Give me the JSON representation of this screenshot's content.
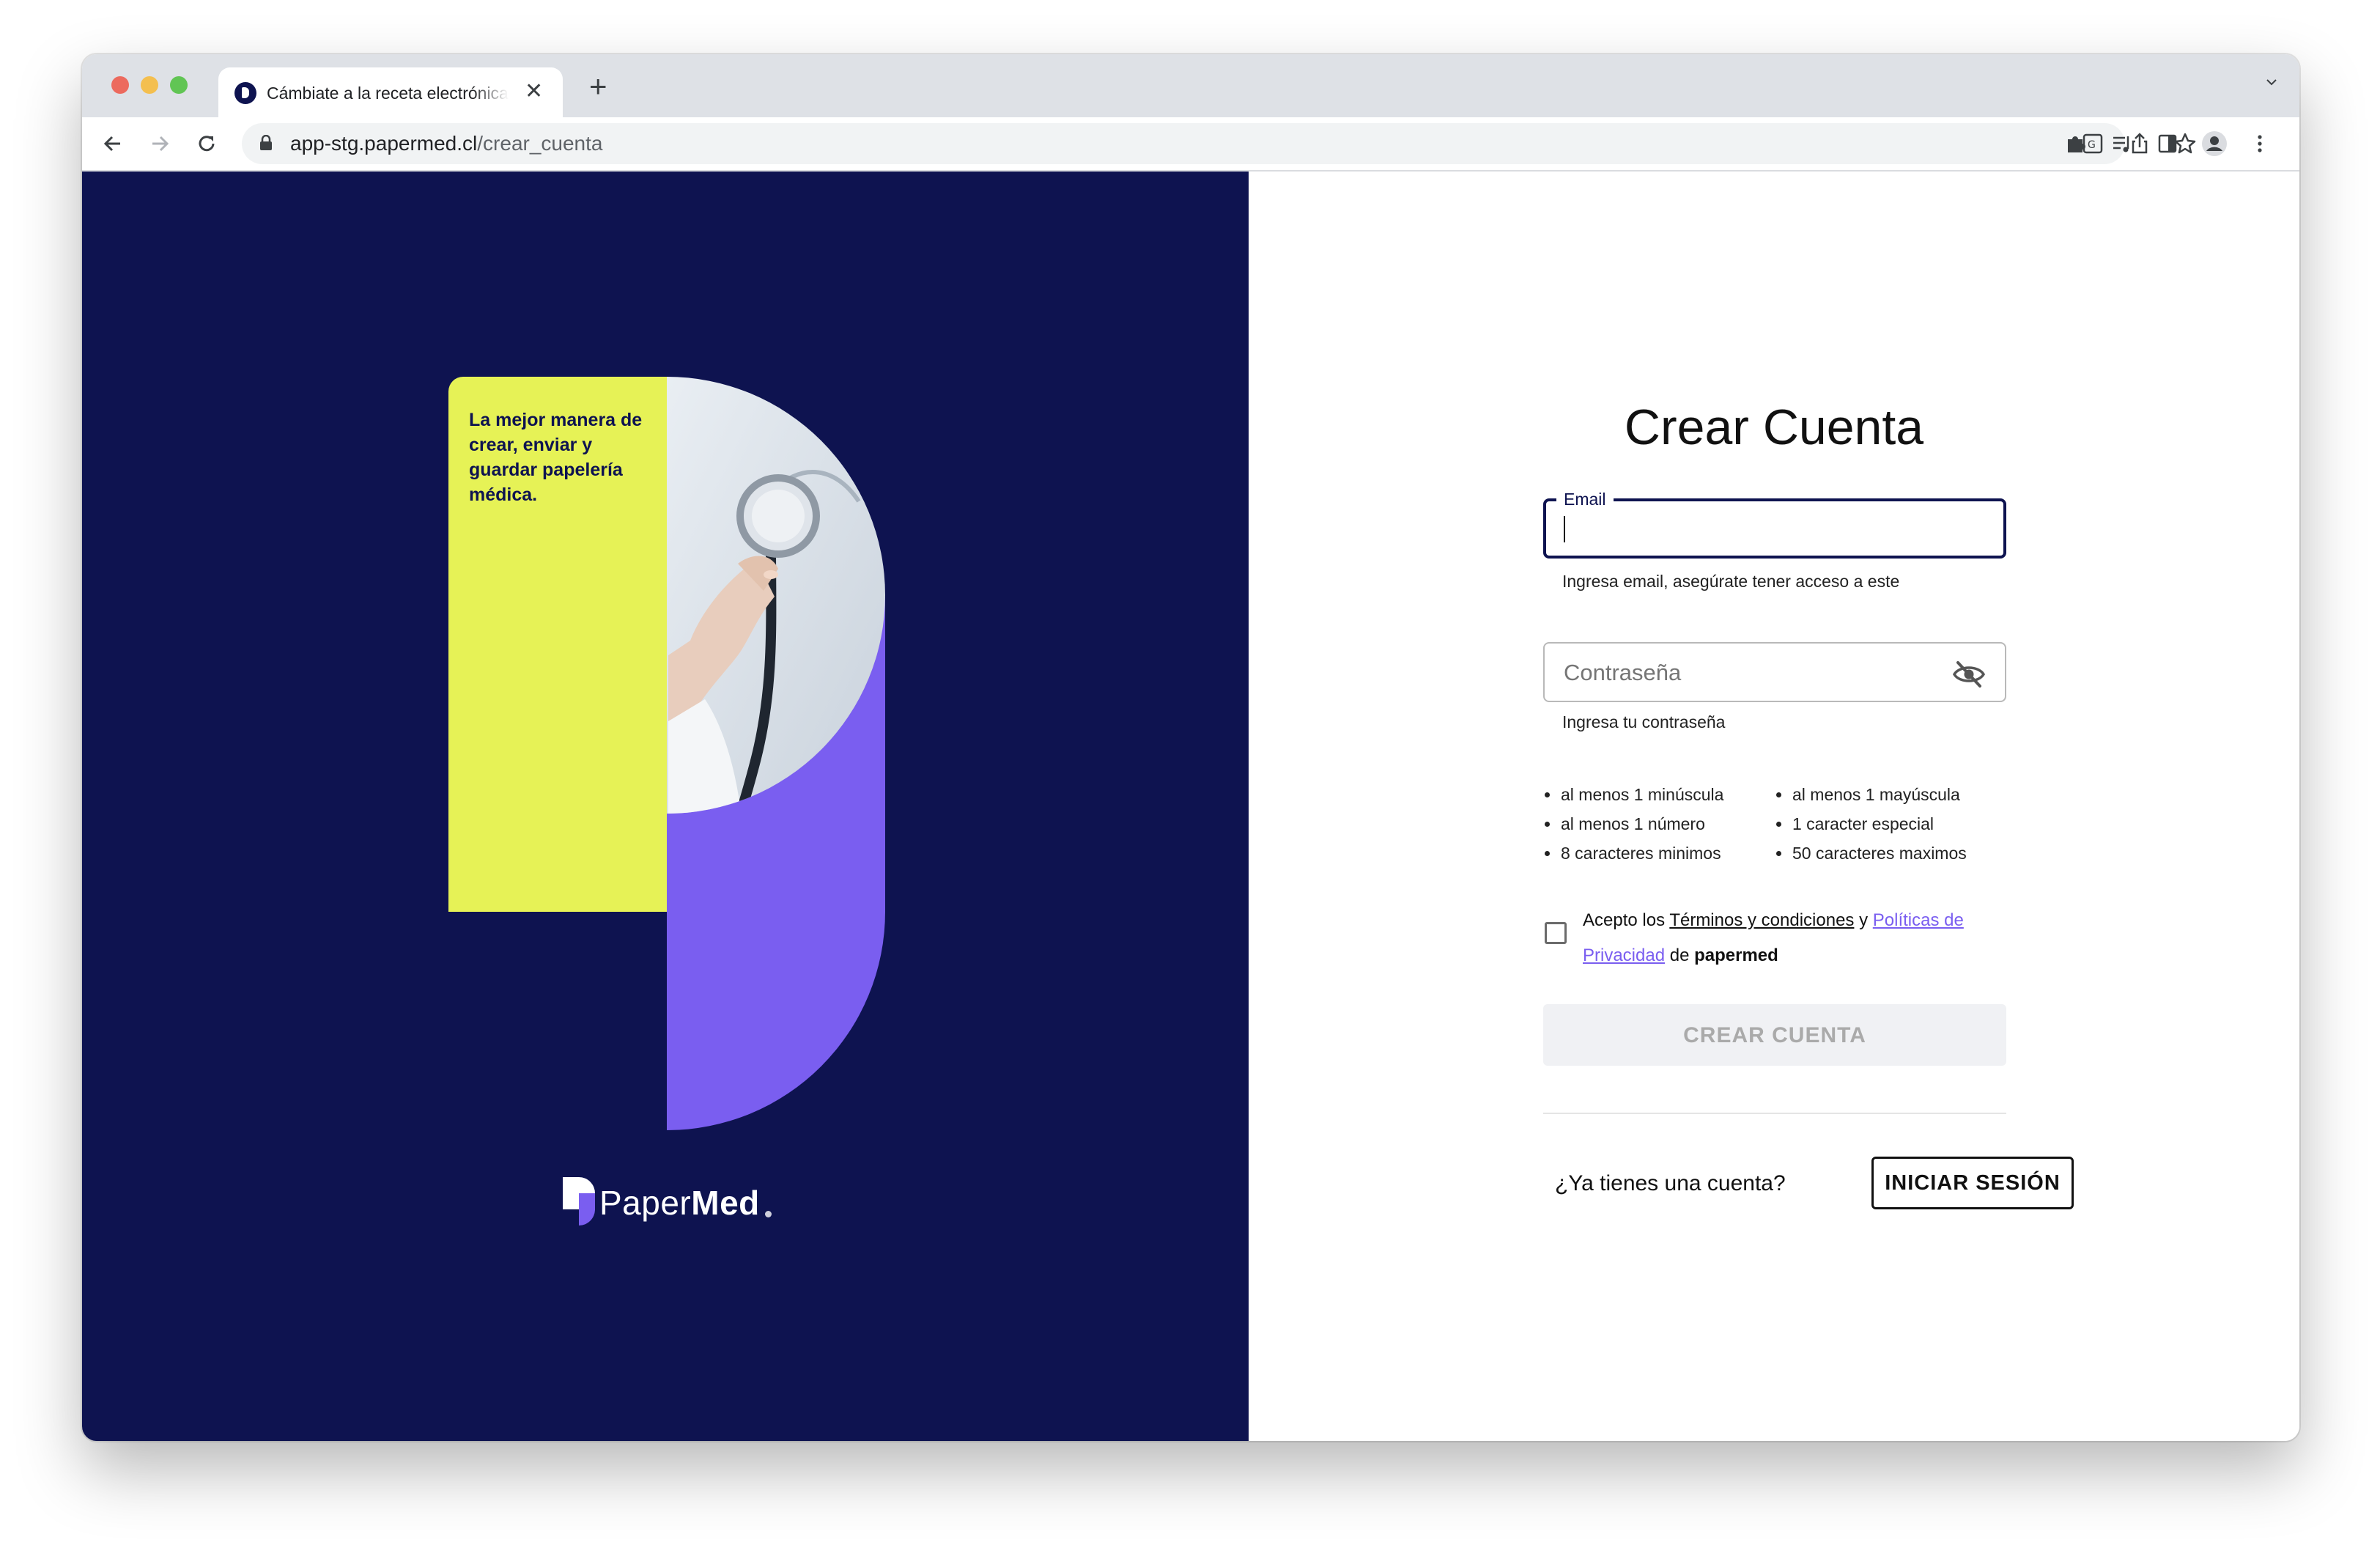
{
  "browser": {
    "tab_title": "Cámbiate a la receta electrónica",
    "url_host": "app-stg.papermed.cl",
    "url_path": "/crear_cuenta"
  },
  "hero": {
    "tagline": "La mejor manera de crear, enviar  y guardar papelería médica.",
    "logo_text_light": "Paper",
    "logo_text_bold": "Med"
  },
  "form": {
    "title": "Crear Cuenta",
    "email_label": "Email",
    "email_value": "",
    "email_helper": "Ingresa email, asegúrate tener acceso a este",
    "password_placeholder": "Contraseña",
    "password_helper": "Ingresa tu contraseña",
    "requirements_left": [
      "al menos 1 minúscula",
      "al menos 1 número",
      "8 caracteres minimos"
    ],
    "requirements_right": [
      "al menos 1 mayúscula",
      "1 caracter especial",
      "50 caracteres maximos"
    ],
    "terms_prefix": "Acepto los ",
    "terms_link": "Términos y condiciones",
    "terms_and": " y ",
    "privacy_link": "Políticas de Privacidad",
    "terms_of": " de ",
    "terms_brand": "papermed",
    "terms_accepted": false,
    "submit_label": "CREAR CUENTA",
    "have_account_text": "¿Ya tienes una cuenta?",
    "login_label": "INICIAR SESIÓN"
  },
  "colors": {
    "navy": "#0e1350",
    "lime": "#e6f256",
    "purple": "#7a5ef0"
  }
}
